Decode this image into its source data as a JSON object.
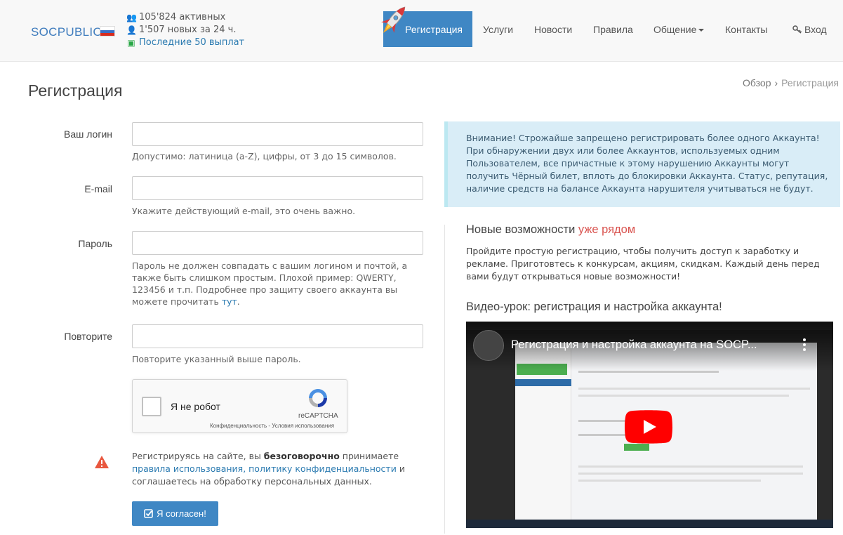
{
  "header": {
    "logo": "SOCPUBLIC",
    "stats": {
      "active": "105'824 активных",
      "new": "1'507 новых за 24 ч.",
      "payouts_link": "Последние 50 выплат"
    },
    "nav": {
      "register": "Регистрация",
      "services": "Услуги",
      "news": "Новости",
      "rules": "Правила",
      "communication": "Общение",
      "contacts": "Контакты",
      "login": "Вход"
    }
  },
  "page": {
    "title": "Регистрация",
    "breadcrumb": {
      "root": "Обзор",
      "sep": "›",
      "current": "Регистрация"
    }
  },
  "form": {
    "login": {
      "label": "Ваш логин",
      "value": "",
      "help": "Допустимо: латиница (a-Z), цифры, от 3 до 15 символов."
    },
    "email": {
      "label": "E-mail",
      "value": "",
      "help": "Укажите действующий e-mail, это очень важно."
    },
    "password": {
      "label": "Пароль",
      "value": "",
      "help": "Пароль не должен совпадать с вашим логином и почтой, а также быть слишком простым. Плохой пример: QWERTY, 123456 и т.п. Подробнее про защиту своего аккаунта вы можете прочитать ",
      "help_link": "тут",
      "help_end": "."
    },
    "repeat": {
      "label": "Повторите",
      "value": "",
      "help": "Повторите указанный выше пароль."
    },
    "captcha": {
      "label": "Я не робот",
      "brand": "reCAPTCHA",
      "terms": "Конфиденциальность - Условия использования"
    },
    "agreement": {
      "part1": "Регистрируясь на сайте, вы ",
      "bold": "безоговорочно",
      "part2": " принимаете ",
      "link": "правила использования, политику конфиденциальности",
      "part3": " и соглашаетесь на обработку персональных данных."
    },
    "submit": "Я согласен!"
  },
  "right": {
    "alert": "Внимание! Строжайше запрещено регистрировать более одного Аккаунта! При обнаружении двух или более Аккаунтов, используемых одним Пользователем, все причастные к этому нарушению Аккаунты могут получить Чёрный билет, вплоть до блокировки Аккаунта. Статус, репутация, наличие средств на балансе Аккаунта нарушителя учитываться не будут.",
    "new_heading": "Новые возможности ",
    "new_heading_accent": "уже рядом",
    "new_text": "Пройдите простую регистрацию, чтобы получить доступ к заработку и рекламе. Приготовтесь к конкурсам, акциям, скидкам. Каждый день перед вами будут открываться новые возможности!",
    "video_heading": "Видео-урок: регистрация и настройка аккаунта!",
    "video_title": "Регистрация и настройка аккаунта на SOCP..."
  },
  "colors": {
    "primary": "#3f87c4",
    "link": "#2a7ab0",
    "alert_bg": "#d9edf7",
    "accent": "#d9534f"
  }
}
